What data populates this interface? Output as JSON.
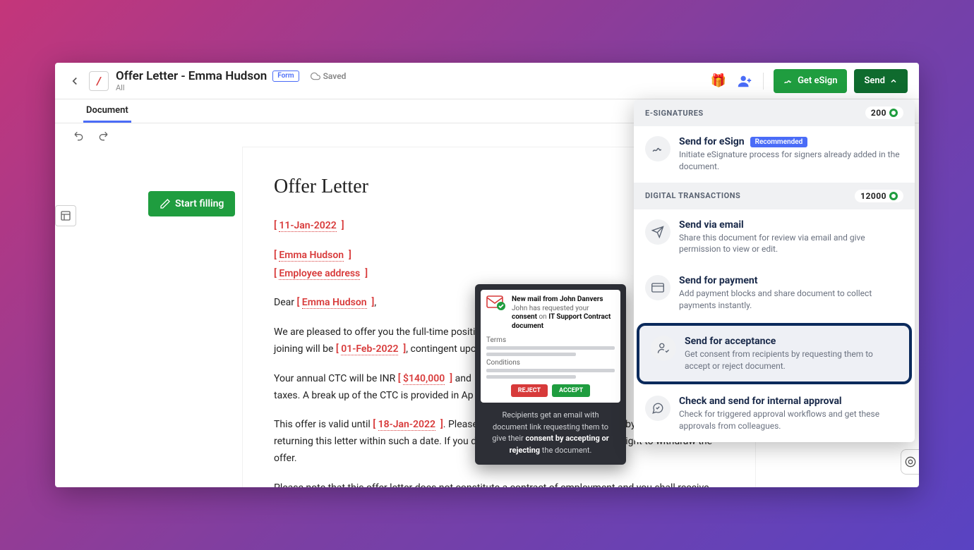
{
  "header": {
    "title": "Offer Letter - Emma Hudson",
    "form_badge": "Form",
    "saved": "Saved",
    "subtitle": "All",
    "get_esign": "Get eSign",
    "send": "Send"
  },
  "tab": {
    "document": "Document"
  },
  "sidebar": {
    "start_filling": "Start filling"
  },
  "doc": {
    "heading": "Offer Letter",
    "date": "11-Jan-2022",
    "name": "Emma Hudson",
    "addr": "Employee address",
    "dear": "Dear",
    "name2": "Emma Hudson",
    "para1a": "We are pleased to offer you the full-time positi",
    "para1b": "joining will be",
    "joindate": "01-Feb-2022",
    "para1c": ", contingent upo",
    "para2a": "Your annual CTC will be INR",
    "ctc": "$140,000",
    "para2b": "and",
    "para2c": "taxes. A break up of the CTC is provided in Ap",
    "para3a": "This offer is valid until",
    "valid": "18-Jan-2022",
    "para3b": ". Please",
    "para3c": "ffer by signing and returning this letter within such a date. If you do",
    "para3d": "have the right to withdraw the offer.",
    "para4": "Please note that this offer letter does not constitute a contract of employment and you shall receive your contract of employment upon joining."
  },
  "dropdown": {
    "sec1": "E-SIGNATURES",
    "count1": "200",
    "sec2": "DIGITAL TRANSACTIONS",
    "count2": "12000",
    "items": [
      {
        "title": "Send for eSign",
        "desc": "Initiate eSignature process for signers already added in the document.",
        "rec": "Recommended"
      },
      {
        "title": "Send via email",
        "desc": "Share this document for review via email and give permission to view or edit."
      },
      {
        "title": "Send for payment",
        "desc": "Add payment blocks and share document to collect payments instantly."
      },
      {
        "title": "Send for acceptance",
        "desc": "Get consent from recipients by requesting them to accept or reject document."
      },
      {
        "title": "Check and send for internal approval",
        "desc": "Check for triggered approval workflows and get these approvals from colleagues."
      }
    ]
  },
  "tooltip": {
    "mail_title": "New mail from John Danvers",
    "mail_sub_a": "John has requested your ",
    "mail_sub_b": "consent",
    "mail_sub_c": " on ",
    "mail_sub_d": "IT Support Contract document",
    "terms": "Terms",
    "conditions": "Conditions",
    "reject": "REJECT",
    "accept": "ACCEPT",
    "foot_a": "Recipients get an email with document link requesting them to give their ",
    "foot_b": "consent by accepting or rejecting",
    "foot_c": " the document."
  }
}
